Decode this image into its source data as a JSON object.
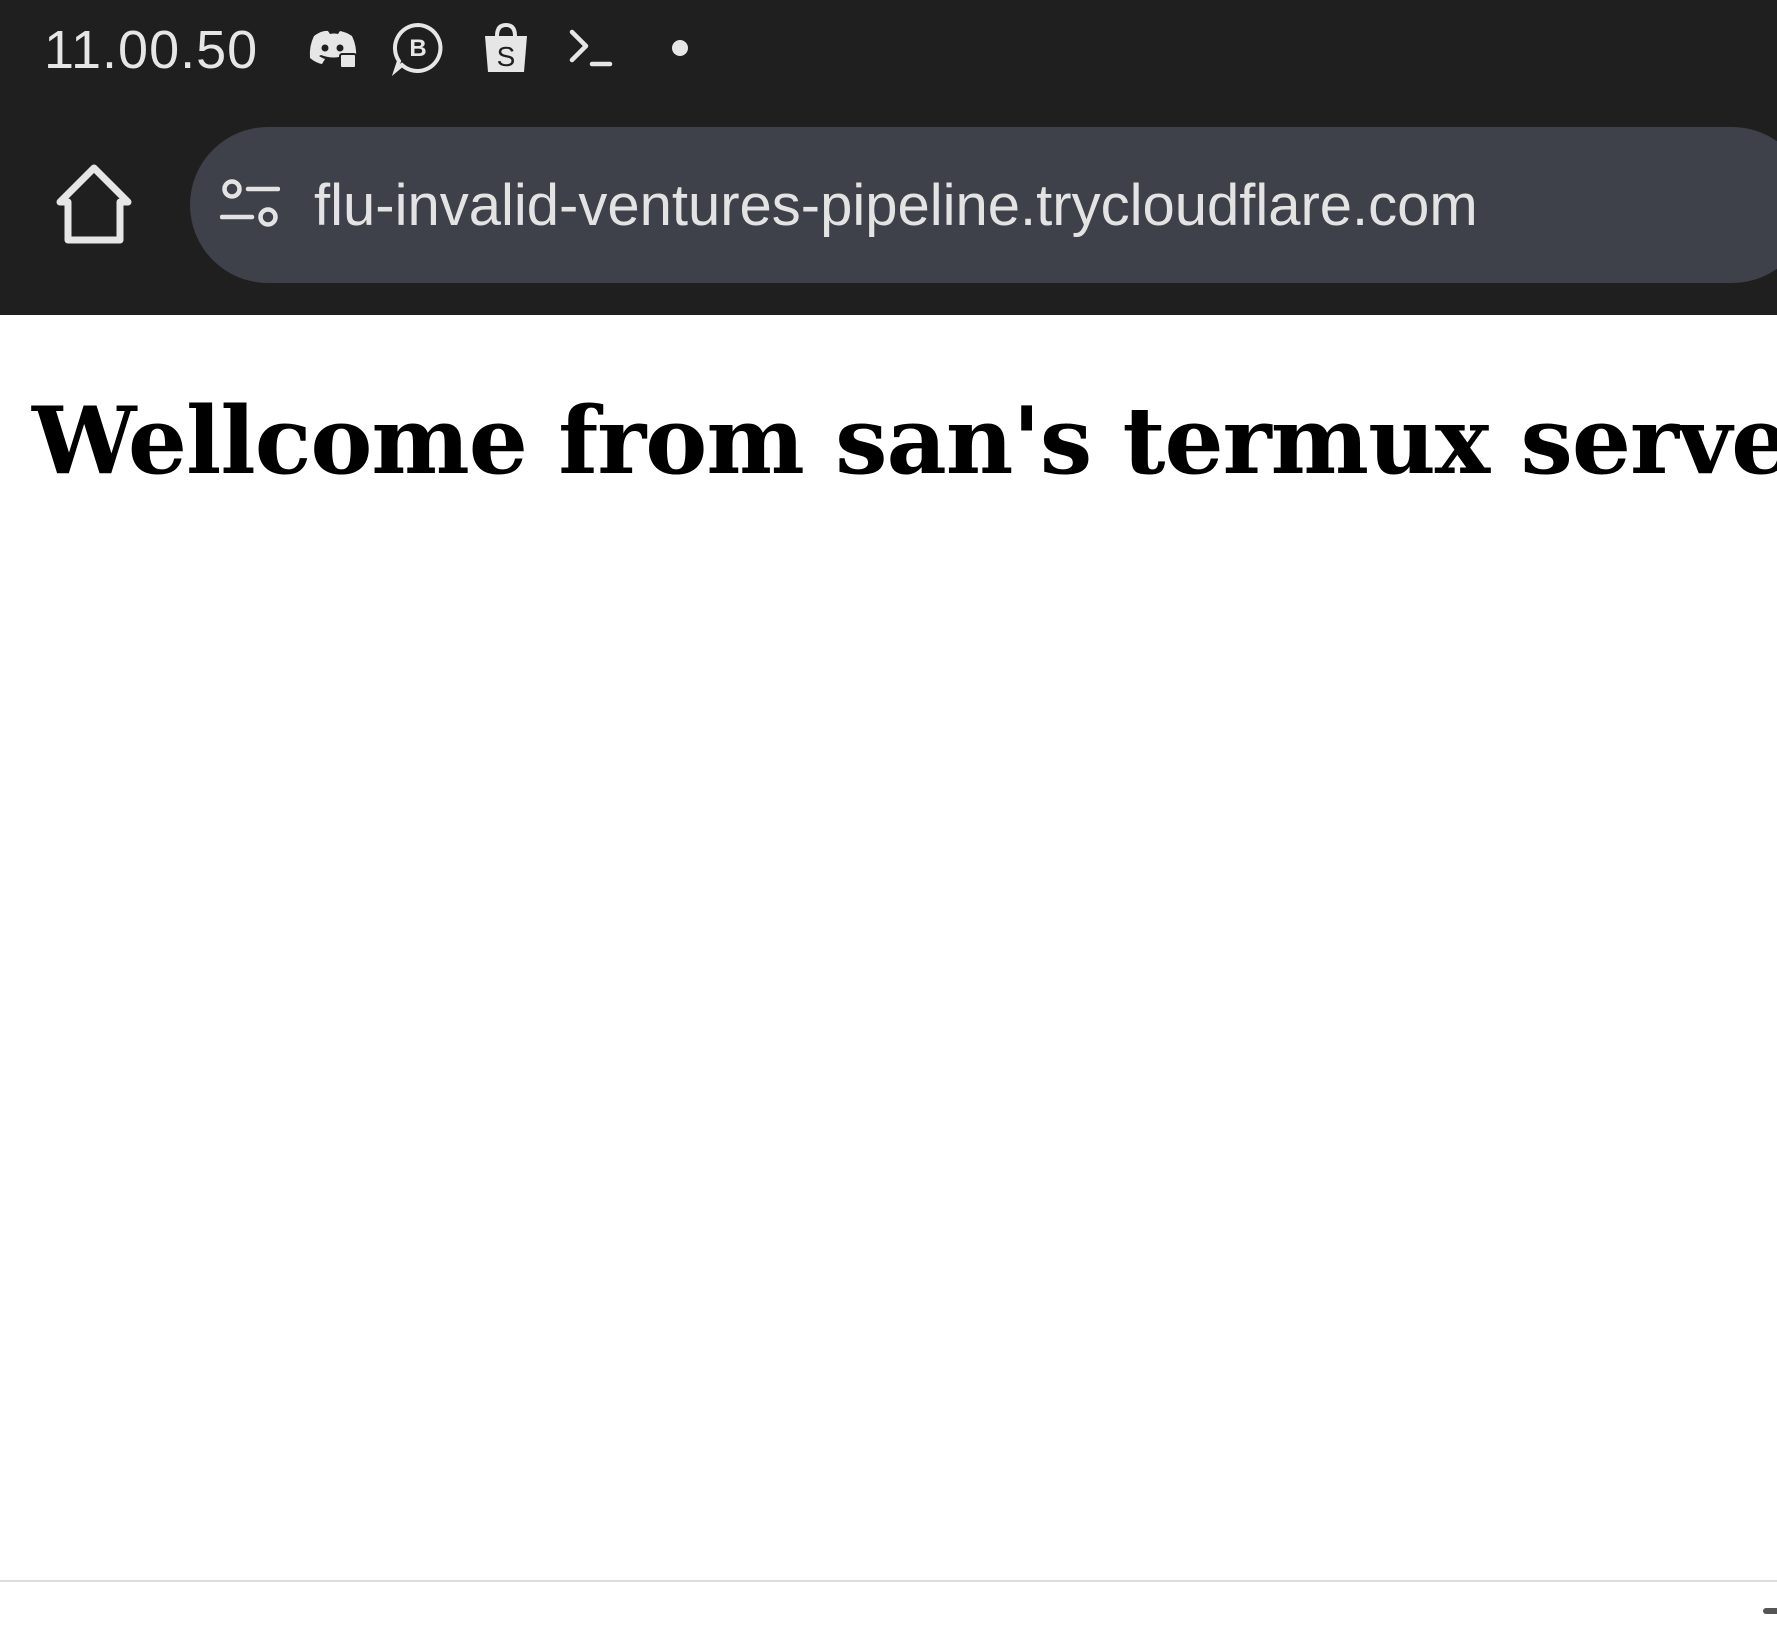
{
  "status_bar": {
    "time": "11.00.50",
    "icons": [
      "discord-icon",
      "whatsapp-business-icon",
      "shopee-bag-icon",
      "terminal-icon",
      "notification-dot-icon"
    ]
  },
  "toolbar": {
    "home_icon": "home-icon",
    "site_info_icon": "tune-icon",
    "url": "flu-invalid-ventures-pipeline.trycloudflare.com"
  },
  "page": {
    "heading": "Wellcome from san's termux server"
  },
  "colors": {
    "chrome_bg": "#1f1f1f",
    "omnibox_bg": "#3e414a",
    "url_text": "#e3e3e3",
    "page_bg": "#ffffff",
    "heading_text": "#000000"
  }
}
